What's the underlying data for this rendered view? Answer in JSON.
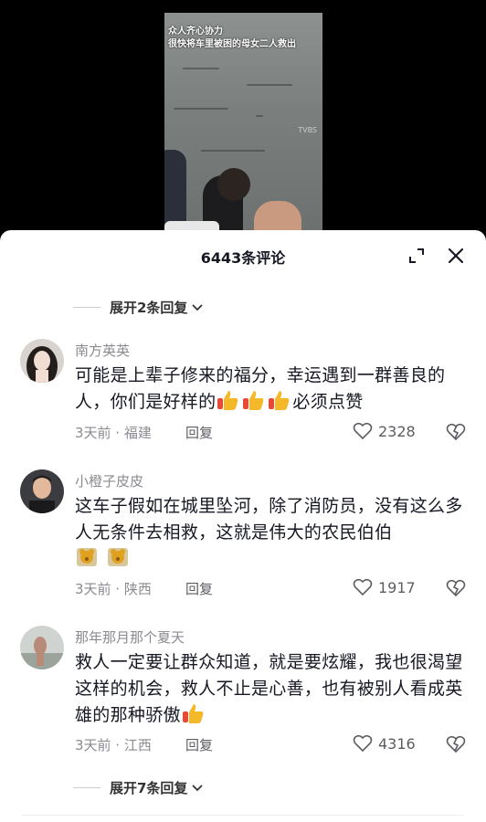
{
  "video": {
    "caption_line1": "众人齐心协力",
    "caption_line2": "很快将车里被困的母女二人救出",
    "watermark": "TVBS"
  },
  "sheet": {
    "title": "6443条评论",
    "expand_icon": "expand-icon",
    "close_icon": "close-icon"
  },
  "replies_top": {
    "label": "展开2条回复"
  },
  "comments": [
    {
      "username": "南方英英",
      "text_1": "可能是上辈子修来的福分，幸运遇到一群善良的人，你们是好样的",
      "text_2": "必须点赞",
      "emoji": "thumbs-up",
      "meta": "3天前 · 福建",
      "reply_label": "回复",
      "likes": "2328"
    },
    {
      "username": "小橙子皮皮",
      "text_1": "这车子假如在城里坠河，除了消防员，没有这么多人无条件去相救，这就是伟大的农民伯伯",
      "emoji": "bear",
      "meta": "3天前 · 陕西",
      "reply_label": "回复",
      "likes": "1917"
    },
    {
      "username": "那年那月那个夏天",
      "text_1": "救人一定要让群众知道，就是要炫耀，我也很渴望这样的机会，救人不止是心善，也有被别人看成英雄的那种骄傲",
      "emoji": "thumbs-up",
      "meta": "3天前 · 江西",
      "reply_label": "回复",
      "likes": "4316"
    }
  ],
  "replies_bottom": {
    "label": "展开7条回复"
  },
  "colors": {
    "text": "#161823",
    "muted": "#8a8b91",
    "emoji_red": "#e84a3a",
    "emoji_yellow": "#f5b828"
  }
}
